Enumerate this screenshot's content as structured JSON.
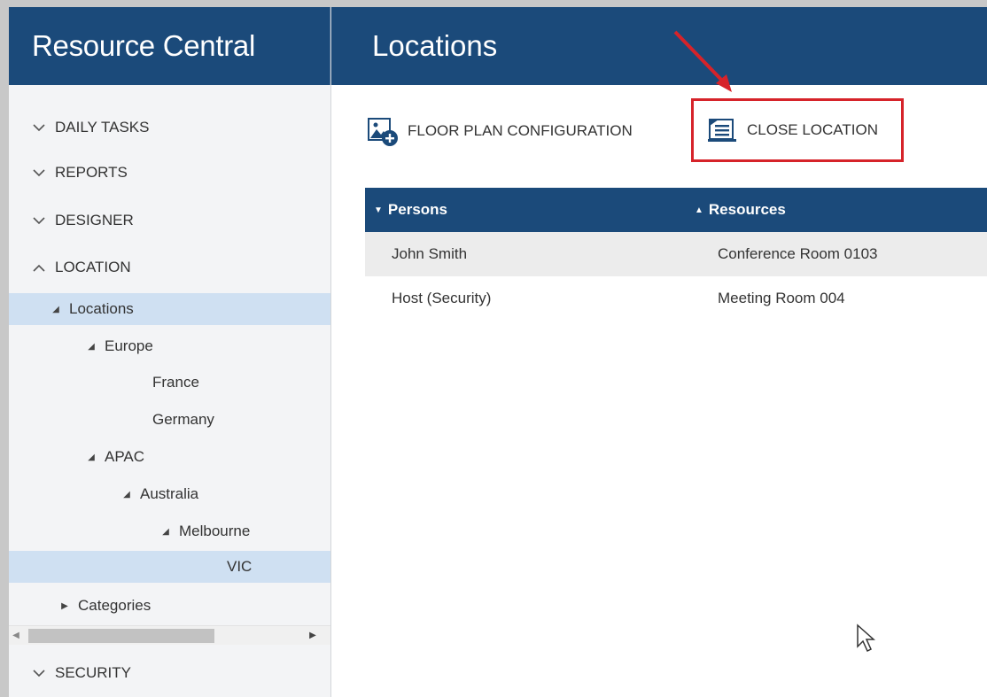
{
  "app": {
    "title": "Resource Central"
  },
  "page": {
    "title": "Locations"
  },
  "sidebar": {
    "sections": [
      {
        "label": "DAILY TASKS",
        "state": "collapsed"
      },
      {
        "label": "REPORTS",
        "state": "collapsed"
      },
      {
        "label": "DESIGNER",
        "state": "collapsed"
      },
      {
        "label": "LOCATION",
        "state": "expanded"
      },
      {
        "label": "SECURITY",
        "state": "collapsed"
      }
    ],
    "tree": [
      {
        "label": "Locations",
        "expander": "expanded",
        "selected": true
      },
      {
        "label": "Europe",
        "expander": "expanded"
      },
      {
        "label": "France",
        "expander": "none"
      },
      {
        "label": "Germany",
        "expander": "none"
      },
      {
        "label": "APAC",
        "expander": "expanded"
      },
      {
        "label": "Australia",
        "expander": "expanded"
      },
      {
        "label": "Melbourne",
        "expander": "expanded"
      },
      {
        "label": "VIC",
        "expander": "none",
        "selected": true
      },
      {
        "label": "Categories",
        "expander": "collapsed"
      }
    ]
  },
  "toolbar": {
    "floor_plan_label": "FLOOR PLAN CONFIGURATION",
    "close_location_label": "CLOSE LOCATION"
  },
  "grid": {
    "columns": [
      {
        "label": "Persons",
        "sort": "descending"
      },
      {
        "label": "Resources",
        "sort": "ascending"
      }
    ],
    "rows": [
      {
        "person": "John Smith",
        "resource": "Conference Room 0103"
      },
      {
        "person": "Host (Security)",
        "resource": "Meeting Room 004"
      }
    ]
  },
  "colors": {
    "header_bg": "#1b4a7a",
    "selected_bg": "#cfe0f2",
    "highlight_border": "#d6232a"
  }
}
